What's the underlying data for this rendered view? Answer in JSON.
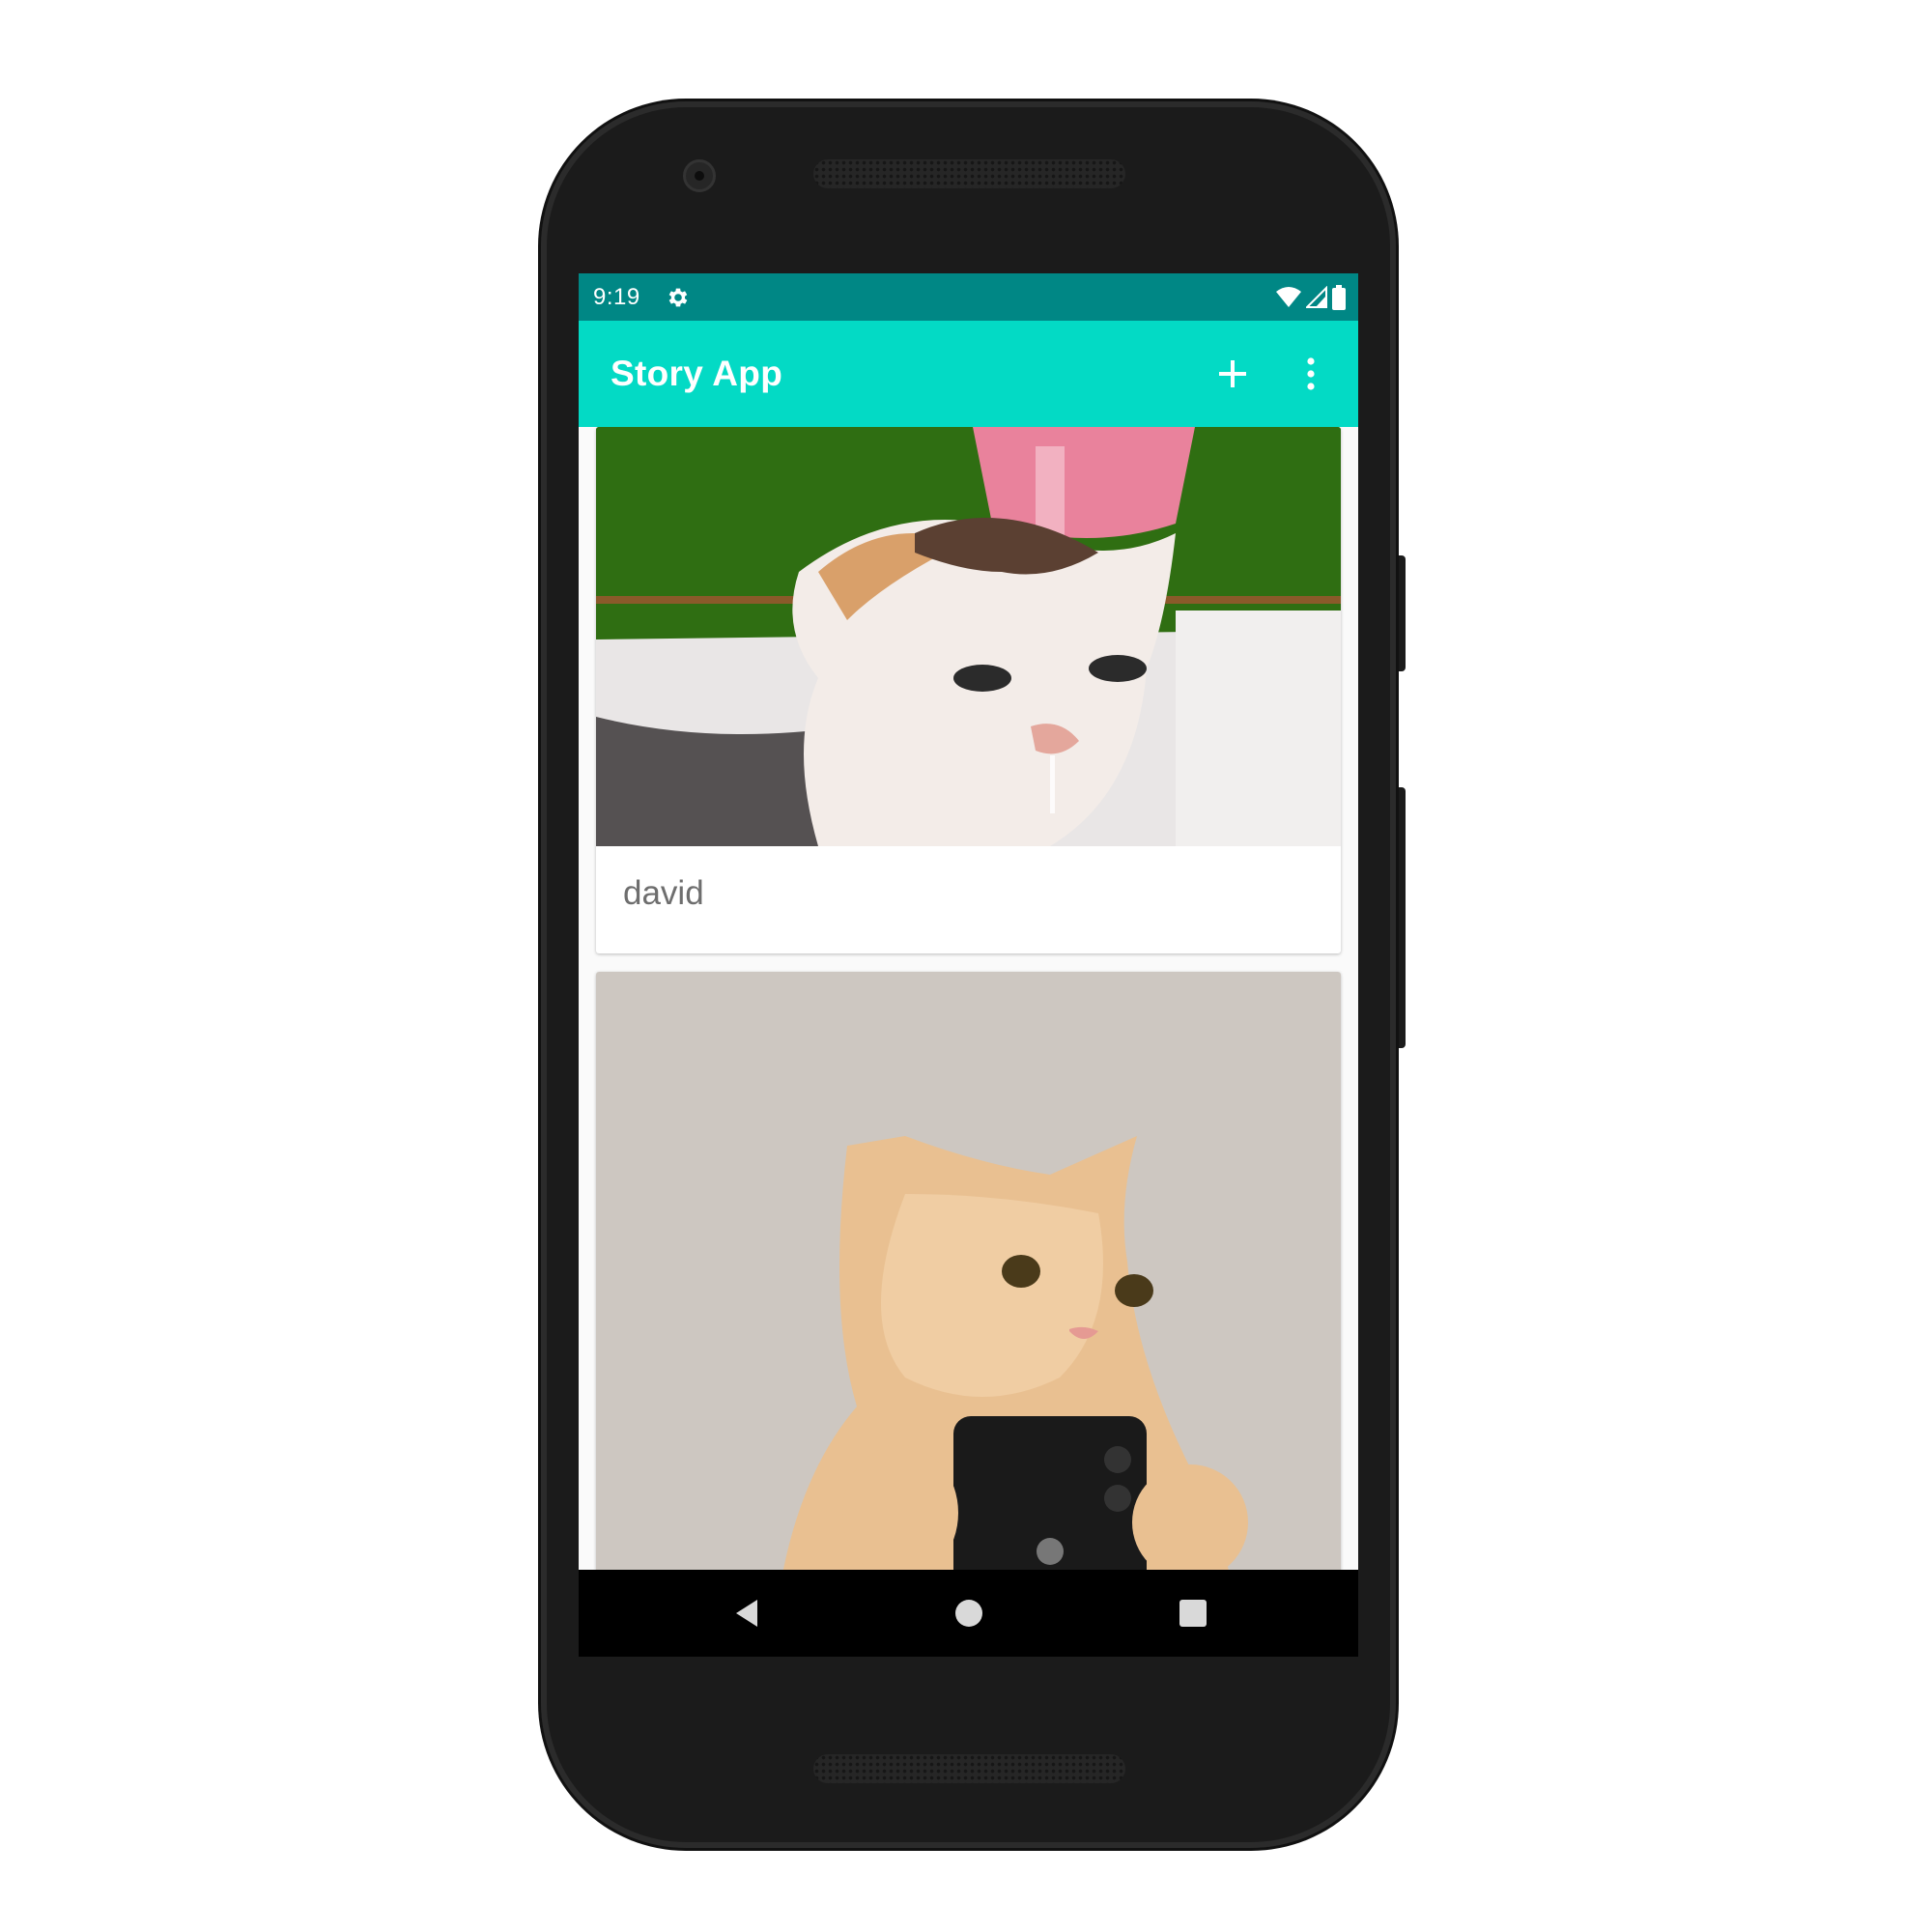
{
  "status_bar": {
    "time": "9:19",
    "icons": [
      "settings-icon",
      "wifi-icon",
      "signal-icon",
      "battery-icon"
    ]
  },
  "app_bar": {
    "title": "Story App",
    "actions": [
      "add-icon",
      "more-vert-icon"
    ]
  },
  "stories": [
    {
      "name": "david",
      "photo": "cat-under-water-bottle-photo"
    },
    {
      "name": "",
      "photo": "cat-holding-phone-selfie-photo"
    }
  ],
  "nav_bar": {
    "buttons": [
      "back-icon",
      "home-icon",
      "recents-icon"
    ]
  },
  "colors": {
    "status_bar": "#008785",
    "app_bar": "#03dac5",
    "nav_bar": "#000000",
    "name_text": "#6e6e6e"
  }
}
